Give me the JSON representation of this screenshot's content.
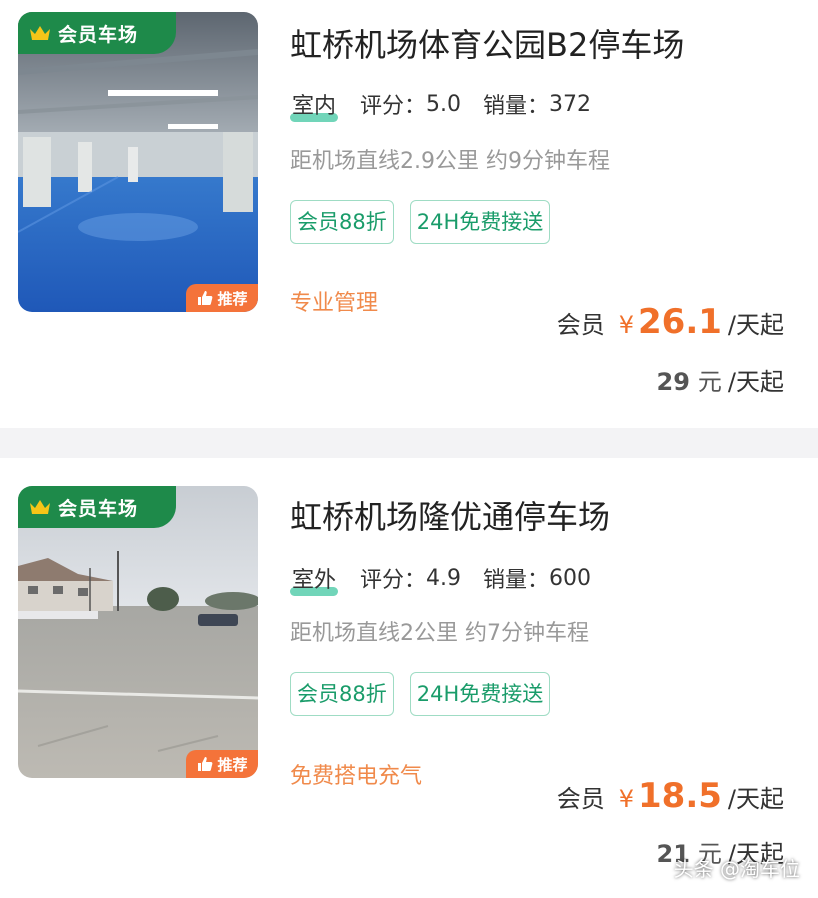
{
  "listings": [
    {
      "member_badge": "会员车场",
      "recommend_badge": "推荐",
      "title": "虹桥机场体育公园B2停车场",
      "location_type": "室内",
      "rating_label": "评分：",
      "rating": "5.0",
      "sales_label": "销量：",
      "sales": "372",
      "distance": "距机场直线2.9公里 约9分钟车程",
      "tags": [
        "会员88折",
        "24H免费接送"
      ],
      "feature": "专业管理",
      "member_price_label": "会员",
      "currency": "¥",
      "member_price": "26.1",
      "price_unit": "/天起",
      "original_price": "29",
      "original_currency": "元",
      "original_unit": "/天起",
      "photo": "indoor-parking-garage"
    },
    {
      "member_badge": "会员车场",
      "recommend_badge": "推荐",
      "title": "虹桥机场隆优通停车场",
      "location_type": "室外",
      "rating_label": "评分：",
      "rating": "4.9",
      "sales_label": "销量：",
      "sales": "600",
      "distance": "距机场直线2公里 约7分钟车程",
      "tags": [
        "会员88折",
        "24H免费接送"
      ],
      "feature": "免费搭电充气",
      "member_price_label": "会员",
      "currency": "¥",
      "member_price": "18.5",
      "price_unit": "/天起",
      "original_price": "21",
      "original_currency": "元",
      "original_unit": "/天起",
      "photo": "outdoor-parking-lot"
    }
  ],
  "watermark": "头条 @淘车位",
  "colors": {
    "badge_green": "#1e8a4a",
    "price_orange": "#f0702a",
    "tag_green": "#1a9c6a",
    "recommend_orange": "#f4733a"
  }
}
